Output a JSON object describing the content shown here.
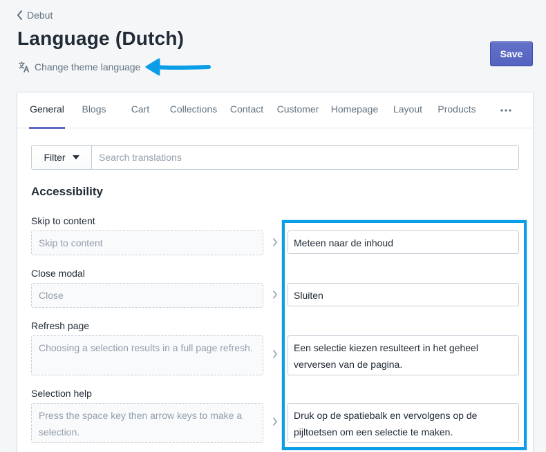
{
  "breadcrumb": {
    "label": "Debut"
  },
  "page": {
    "title": "Language (Dutch)"
  },
  "change_language": {
    "label": "Change theme language"
  },
  "toolbar": {
    "save_label": "Save"
  },
  "tabs": [
    {
      "label": "General",
      "active": true
    },
    {
      "label": "Blogs",
      "active": false
    },
    {
      "label": "Cart",
      "active": false
    },
    {
      "label": "Collections",
      "active": false
    },
    {
      "label": "Contact",
      "active": false
    },
    {
      "label": "Customer",
      "active": false
    },
    {
      "label": "Homepage",
      "active": false
    },
    {
      "label": "Layout",
      "active": false
    },
    {
      "label": "Products",
      "active": false
    }
  ],
  "more_tabs_icon": "horizontal-dots-icon",
  "filter": {
    "label": "Filter"
  },
  "search": {
    "placeholder": "Search translations",
    "value": ""
  },
  "section": {
    "title": "Accessibility"
  },
  "rows": [
    {
      "label": "Skip to content",
      "source": "Skip to content",
      "translation": "Meteen naar de inhoud"
    },
    {
      "label": "Close modal",
      "source": "Close",
      "translation": "Sluiten"
    },
    {
      "label": "Refresh page",
      "source": "Choosing a selection results in a full page refresh.",
      "translation": "Een selectie kiezen resulteert in het geheel verversen van de pagina."
    },
    {
      "label": "Selection help",
      "source": "Press the space key then arrow keys to make a selection.",
      "translation": "Druk op de spatiebalk en vervolgens op de pijltoetsen om een selectie te maken."
    }
  ],
  "colors": {
    "accent": "#5c6ac4",
    "annotation": "#0b9ee8",
    "muted_text": "#637381",
    "placeholder": "#919eab"
  }
}
